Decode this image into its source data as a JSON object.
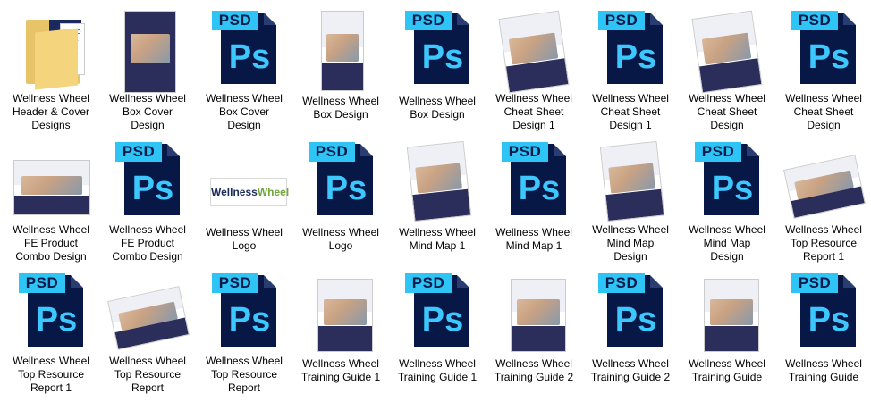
{
  "items": [
    {
      "label": "Wellness Wheel\nHeader & Cover\nDesigns",
      "icon": "folder-icon"
    },
    {
      "label": "Wellness Wheel\nBox Cover\nDesign",
      "icon": "box-cover-image"
    },
    {
      "label": "Wellness Wheel\nBox Cover\nDesign",
      "icon": "psd-file-icon"
    },
    {
      "label": "Wellness Wheel\nBox Design",
      "icon": "box-image"
    },
    {
      "label": "Wellness Wheel\nBox Design",
      "icon": "psd-file-icon"
    },
    {
      "label": "Wellness Wheel\nCheat Sheet\nDesign 1",
      "icon": "cheat-sheet-image"
    },
    {
      "label": "Wellness Wheel\nCheat Sheet\nDesign 1",
      "icon": "psd-file-icon"
    },
    {
      "label": "Wellness Wheel\nCheat Sheet\nDesign",
      "icon": "cheat-sheet-image"
    },
    {
      "label": "Wellness Wheel\nCheat Sheet\nDesign",
      "icon": "psd-file-icon"
    },
    {
      "label": "Wellness Wheel\nFE Product\nCombo Design",
      "icon": "combo-image"
    },
    {
      "label": "Wellness Wheel\nFE Product\nCombo Design",
      "icon": "psd-file-icon"
    },
    {
      "label": "Wellness Wheel\nLogo",
      "icon": "logo-image"
    },
    {
      "label": "Wellness Wheel\nLogo",
      "icon": "psd-file-icon"
    },
    {
      "label": "Wellness Wheel\nMind Map 1",
      "icon": "mind-map-image"
    },
    {
      "label": "Wellness Wheel\nMind Map 1",
      "icon": "psd-file-icon"
    },
    {
      "label": "Wellness Wheel\nMind Map\nDesign",
      "icon": "mind-map-image"
    },
    {
      "label": "Wellness Wheel\nMind Map\nDesign",
      "icon": "psd-file-icon"
    },
    {
      "label": "Wellness Wheel\nTop Resource\nReport 1",
      "icon": "report-image"
    },
    {
      "label": "Wellness Wheel\nTop Resource\nReport 1",
      "icon": "psd-file-icon"
    },
    {
      "label": "Wellness Wheel\nTop Resource\nReport",
      "icon": "report-image"
    },
    {
      "label": "Wellness Wheel\nTop Resource\nReport",
      "icon": "psd-file-icon"
    },
    {
      "label": "Wellness Wheel\nTraining Guide 1",
      "icon": "training-guide-image"
    },
    {
      "label": "Wellness Wheel\nTraining Guide 1",
      "icon": "psd-file-icon"
    },
    {
      "label": "Wellness Wheel\nTraining Guide 2",
      "icon": "training-guide-image"
    },
    {
      "label": "Wellness Wheel\nTraining Guide 2",
      "icon": "psd-file-icon"
    },
    {
      "label": "Wellness Wheel\nTraining Guide",
      "icon": "training-guide-image"
    },
    {
      "label": "Wellness Wheel\nTraining Guide",
      "icon": "psd-file-icon"
    }
  ],
  "psd_tag": "PSD",
  "ps_text": "Ps",
  "folder_peek_text": "mpro\nyour\necre",
  "logo_text_a": "Wellness",
  "logo_text_b": "Wheel",
  "colors": {
    "psd_dark": "#071847",
    "psd_cyan": "#2ec4f5",
    "folder": "#f4d57e",
    "cover_navy": "#2b2d5b"
  }
}
